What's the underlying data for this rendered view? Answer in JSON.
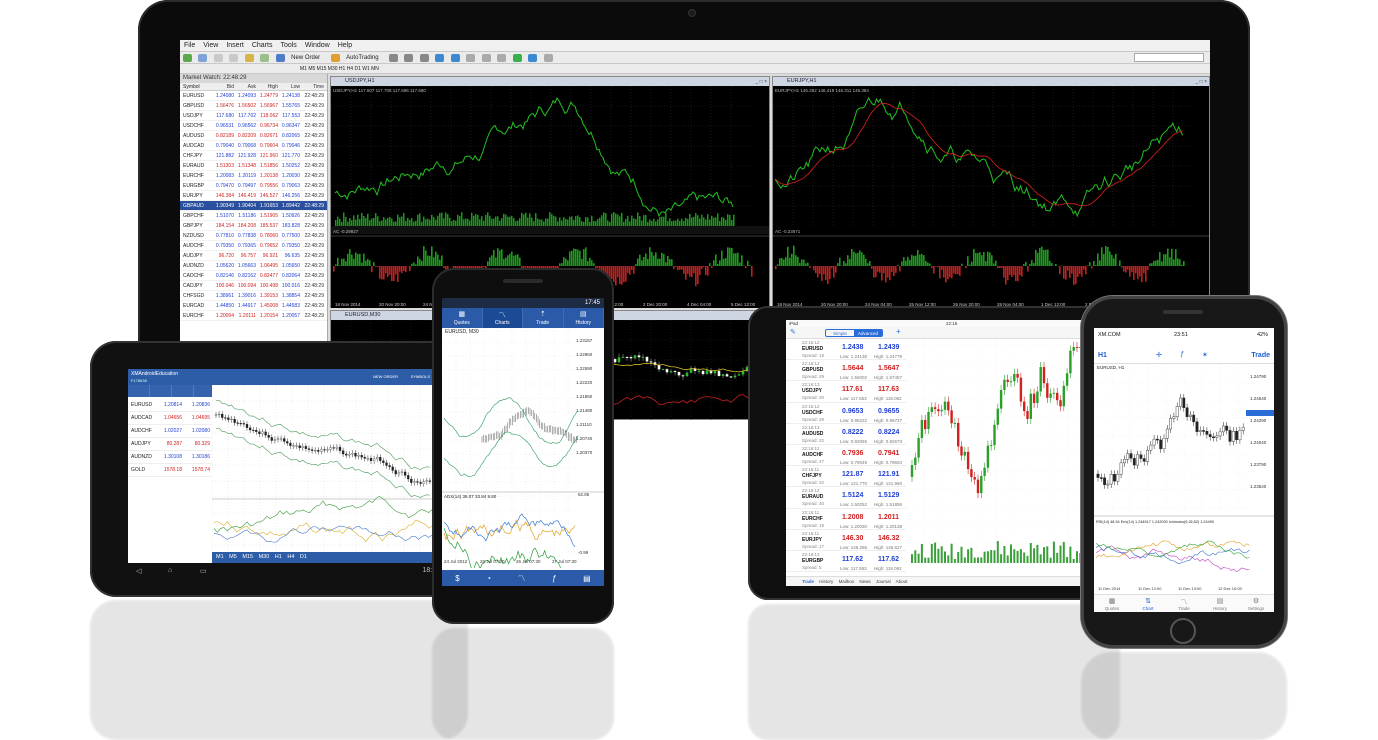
{
  "desktop": {
    "menu": [
      "File",
      "View",
      "Insert",
      "Charts",
      "Tools",
      "Window",
      "Help"
    ],
    "toolbar": {
      "new_order": "New Order",
      "autotrading": "AutoTrading"
    },
    "timeframes": "M1 M5 M15 M30 H1 H4 D1 W1 MN",
    "market_watch": {
      "title": "Market Watch: 22:48:29",
      "headers": [
        "Symbol",
        "Bid",
        "Ask",
        "High",
        "Low",
        "Time"
      ],
      "rows": [
        [
          "EURUSD",
          "1.24080",
          "1.24093",
          "1.24779",
          "1.24138",
          "22:48:29"
        ],
        [
          "GBPUSD",
          "1.56476",
          "1.56502",
          "1.56967",
          "1.55765",
          "22:48:29"
        ],
        [
          "USDJPY",
          "117.680",
          "117.702",
          "118.062",
          "117.553",
          "22:48:29"
        ],
        [
          "USDCHF",
          "0.96531",
          "0.96562",
          "0.96734",
          "0.96347",
          "22:48:29"
        ],
        [
          "AUDUSD",
          "0.82189",
          "0.82209",
          "0.82671",
          "0.82065",
          "22:48:29"
        ],
        [
          "AUDCAD",
          "0.79040",
          "0.79068",
          "0.79604",
          "0.79046",
          "22:48:29"
        ],
        [
          "CHFJPY",
          "121.882",
          "121.928",
          "121.960",
          "121.770",
          "22:48:29"
        ],
        [
          "EURAUD",
          "1.51303",
          "1.51348",
          "1.51856",
          "1.50252",
          "22:48:29"
        ],
        [
          "EURCHF",
          "1.20083",
          "1.20119",
          "1.20138",
          "1.20030",
          "22:48:29"
        ],
        [
          "EURGBP",
          "0.79470",
          "0.79497",
          "0.79556",
          "0.79063",
          "22:48:29"
        ],
        [
          "EURJPY",
          "146.384",
          "146.419",
          "146.527",
          "146.256",
          "22:48:29"
        ],
        [
          "GBPAUD",
          "1.90349",
          "1.90404",
          "1.91653",
          "1.89442",
          "22:48:29"
        ],
        [
          "GBPCHF",
          "1.51070",
          "1.51186",
          "1.51905",
          "1.50926",
          "22:48:29"
        ],
        [
          "GBPJPY",
          "184.154",
          "184.208",
          "185.537",
          "183.828",
          "22:48:29"
        ],
        [
          "NZDUSD",
          "0.77810",
          "0.77838",
          "0.78060",
          "0.77500",
          "22:48:29"
        ],
        [
          "AUDCHF",
          "0.79350",
          "0.79365",
          "0.79652",
          "0.79350",
          "22:48:29"
        ],
        [
          "AUDJPY",
          "96.720",
          "96.757",
          "96.921",
          "96.635",
          "22:48:29"
        ],
        [
          "AUDNZD",
          "1.05620",
          "1.05663",
          "1.06495",
          "1.05650",
          "22:48:29"
        ],
        [
          "CADCHF",
          "0.82146",
          "0.82162",
          "0.82477",
          "0.82064",
          "22:48:29"
        ],
        [
          "CADJPY",
          "100.046",
          "100.094",
          "100.498",
          "100.016",
          "22:48:29"
        ],
        [
          "CHFSGD",
          "1.38961",
          "1.39016",
          "1.39153",
          "1.38854",
          "22:48:29"
        ],
        [
          "EURCAD",
          "1.44850",
          "1.44917",
          "1.45008",
          "1.44583",
          "22:48:29"
        ],
        [
          "EURCHF",
          "1.20094",
          "1.20111",
          "1.20154",
          "1.20057",
          "22:48:29"
        ]
      ]
    },
    "charts": {
      "usdjpy": {
        "title": "USDJPY,H1",
        "sub": "USDJPY,H1 117.607 117.708 117.596 117.680",
        "ac": "AC -0.29927"
      },
      "eurjpy": {
        "title": "EURJPY,H1",
        "sub": "EURJPY,H1 146.352 146.419 146.311 146.384",
        "ac": "AC -0.23671"
      },
      "eurusd": {
        "title": "EURUSD,M30"
      },
      "xaxis": [
        "18 Nov 2014",
        "20 Nov 20:00",
        "24 Nov 04:00",
        "25 Nov 12:00",
        "26 Nov 20:00",
        "28 Nov 04:00",
        "1 Dec 12:00",
        "2 Dec 20:00",
        "4 Dec 04:00",
        "5 Dec 12:00"
      ]
    }
  },
  "android_tablet": {
    "app_title": "XMAndroidEducation",
    "account": "F178638",
    "btn_new_order": "NEW ORDER",
    "btn_symbols": "SYMBOLS",
    "quotes": [
      {
        "symbol": "EURUSD",
        "bid": "1.20814",
        "ask": "1.20836"
      },
      {
        "symbol": "AUDCAD",
        "bid": "1.04656",
        "ask": "1.04695"
      },
      {
        "symbol": "AUDCHF",
        "bid": "1.02027",
        "ask": "1.02080"
      },
      {
        "symbol": "AUDJPY",
        "bid": "80.287",
        "ask": "80.329"
      },
      {
        "symbol": "AUDNZD",
        "bid": "1.30108",
        "ask": "1.30186"
      },
      {
        "symbol": "GOLD",
        "bid": "1578.18",
        "ask": "1578.74"
      }
    ],
    "timeframes": "M1 M5 M15 M30 H1 H4 D1",
    "clock": "18:03"
  },
  "android_phone": {
    "time": "17:45",
    "tabs": [
      "Quotes",
      "Charts",
      "Trade",
      "History"
    ],
    "symbol": "EURUSD, M30",
    "price_labels": [
      "1.23157",
      "1.22960",
      "1.22590",
      "1.22220",
      "1.21850",
      "1.21480",
      "1.21110",
      "1.20740",
      "1.20370"
    ],
    "indicator": "ADX(14) 36.07 33.84 9.80",
    "ind_labels": [
      "62.85",
      "-0.99"
    ],
    "dates": [
      "24 Jul 2012",
      "26 Jul 07:30",
      "26 Jul 07:30",
      "27 Jul 07:30"
    ]
  },
  "ipad": {
    "status": "iPad",
    "time": "22:16",
    "seg": [
      "Simple",
      "Advanced"
    ],
    "quotes": [
      {
        "time": "22:16:12",
        "symbol": "EURUSD",
        "spread": "Spread: 18",
        "bid_big": "1.24",
        "bid_pips": "38",
        "ask_big": "1.24",
        "ask_pips": "39",
        "low": "Low: 1.24138",
        "high": "High: 1.24779"
      },
      {
        "time": "22:16:12",
        "symbol": "GBPUSD",
        "spread": "Spread: 29",
        "bid_big": "1.56",
        "bid_pips": "44",
        "ask_big": "1.56",
        "ask_pips": "47",
        "low": "Low: 1.56002",
        "high": "High: 1.57457"
      },
      {
        "time": "22:16:13",
        "symbol": "USDJPY",
        "spread": "Spread: 20",
        "bid_big": "117.",
        "bid_pips": "61",
        "ask_big": "117.",
        "ask_pips": "63",
        "low": "Low: 117.553",
        "high": "High: 118.062"
      },
      {
        "time": "22:16:12",
        "symbol": "USDCHF",
        "spread": "Spread: 29",
        "bid_big": "0.96",
        "bid_pips": "53",
        "ask_big": "0.96",
        "ask_pips": "55",
        "low": "Low: 0.96222",
        "high": "High: 0.96727"
      },
      {
        "time": "22:16:13",
        "symbol": "AUDUSD",
        "spread": "Spread: 22",
        "bid_big": "0.82",
        "bid_pips": "22",
        "ask_big": "0.82",
        "ask_pips": "24",
        "low": "Low: 0.82065",
        "high": "High: 0.82673"
      },
      {
        "time": "22:16:12",
        "symbol": "AUDCHF",
        "spread": "Spread: 47",
        "bid_big": "0.79",
        "bid_pips": "36",
        "ask_big": "0.79",
        "ask_pips": "41",
        "low": "Low: 0.79049",
        "high": "High: 0.79604"
      },
      {
        "time": "22:16:11",
        "symbol": "CHFJPY",
        "spread": "Spread: 32",
        "bid_big": "121.",
        "bid_pips": "87",
        "ask_big": "121.",
        "ask_pips": "91",
        "low": "Low: 121.770",
        "high": "High: 121.960"
      },
      {
        "time": "22:16:12",
        "symbol": "EURAUD",
        "spread": "Spread: 40",
        "bid_big": "1.51",
        "bid_pips": "24",
        "ask_big": "1.51",
        "ask_pips": "29",
        "low": "Low: 1.50252",
        "high": "High: 1.51856"
      },
      {
        "time": "22:16:11",
        "symbol": "EURCHF",
        "spread": "Spread: 19",
        "bid_big": "1.20",
        "bid_pips": "08",
        "ask_big": "1.20",
        "ask_pips": "11",
        "low": "Low: 1.20030",
        "high": "High: 1.20138"
      },
      {
        "time": "22:16:11",
        "symbol": "EURJPY",
        "spread": "Spread: 17",
        "bid_big": "146.",
        "bid_pips": "30",
        "ask_big": "146.",
        "ask_pips": "32",
        "low": "Low: 146.256",
        "high": "High: 146.527"
      },
      {
        "time": "22:16:13",
        "symbol": "EURGBP",
        "spread": "Spread: 5",
        "bid_big": "117.",
        "bid_pips": "62",
        "ask_big": "117.",
        "ask_pips": "62",
        "low": "Low: 117.553",
        "high": "High: 118.062"
      }
    ],
    "bottom": [
      "Trade",
      "History",
      "Mailbox",
      "News",
      "Journal",
      "About"
    ]
  },
  "iphone": {
    "carrier": "XM.COM",
    "time": "23:51",
    "battery": "42%",
    "nav_left": "H1",
    "nav_right": "Trade",
    "symbol": "EURUSD, H1",
    "price_labels": [
      "1.24790",
      "1.24540",
      "1.24290",
      "1.24040",
      "1.23790",
      "1.23540"
    ],
    "indicator": "RSI(14) 48.34 Env(14) 1.244517 1.242030 Ichimoku(9,26,52) 1.24490",
    "dates": [
      "11 Dec 2014",
      "11 Dec 12:00",
      "11 Dec 13:00",
      "12 Dec 10:00"
    ],
    "tabs": [
      "Quotes",
      "Chart",
      "Trade",
      "History",
      "Settings"
    ]
  }
}
